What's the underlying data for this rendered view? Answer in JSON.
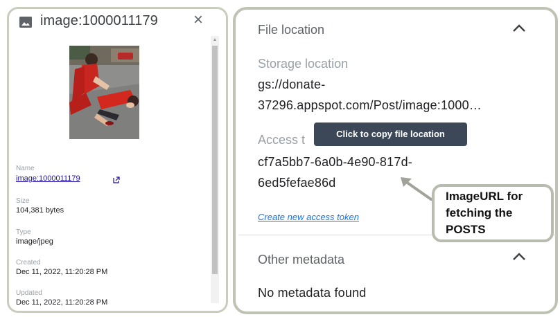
{
  "left": {
    "title": "image:1000011179",
    "close_label": "×",
    "meta": {
      "name_label": "Name",
      "name_value": "image:1000011179",
      "size_label": "Size",
      "size_value": "104,381 bytes",
      "type_label": "Type",
      "type_value": "image/jpeg",
      "created_label": "Created",
      "created_value": "Dec 11, 2022, 11:20:28 PM",
      "updated_label": "Updated",
      "updated_value": "Dec 11, 2022, 11:20:28 PM"
    }
  },
  "right": {
    "file_location_title": "File location",
    "storage_label": "Storage location",
    "storage_value_line1": "gs://donate-",
    "storage_value_line2": "37296.appspot.com/Post/image:1000…",
    "access_label_partial": "Access t",
    "access_value_line1": "cf7a5bb7-6a0b-4e90-817d-",
    "access_value_line2": "6ed5fefae86d",
    "create_token_link": "Create new access token",
    "tooltip": "Click to copy file location",
    "other_metadata_title": "Other metadata",
    "no_metadata": "No metadata found"
  },
  "annotation": {
    "line1": "ImageURL for",
    "line2": "fetching the",
    "line3": "POSTS"
  },
  "icons": {
    "file_type": "image-icon",
    "close": "close-icon",
    "external_link": "external-link-icon",
    "collapse": "chevron-up-icon",
    "annotation_arrow": "arrow-icon"
  },
  "colors": {
    "link": "#1a73e8",
    "tooltip_bg": "#3c4858",
    "panel_border": "#c9cdbd"
  }
}
